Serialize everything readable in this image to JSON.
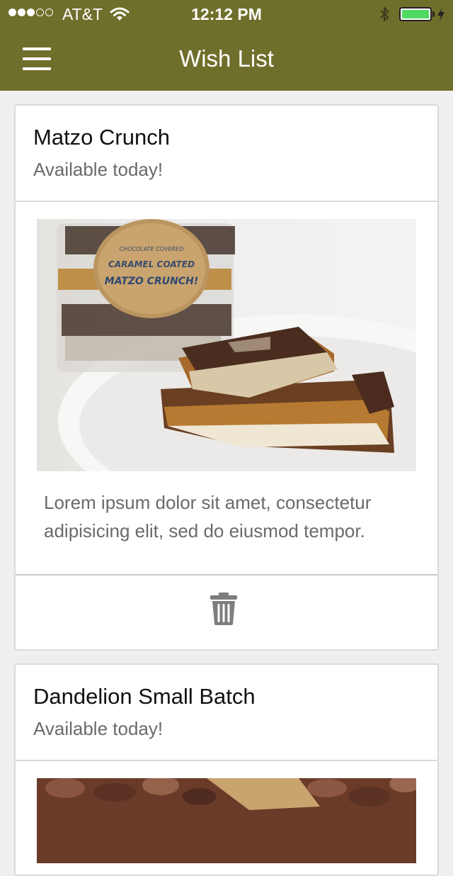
{
  "status_bar": {
    "carrier": "AT&T",
    "time": "12:12 PM",
    "signal_bars_filled": 3,
    "signal_bars_total": 5,
    "battery_level": 1.0,
    "battery_color": "#4cd964",
    "icons": [
      "wifi-icon",
      "bluetooth-icon",
      "battery-icon",
      "charging-icon"
    ]
  },
  "nav": {
    "title": "Wish List",
    "menu_icon": "hamburger-menu-icon",
    "bar_color": "#6f6f2c"
  },
  "items": [
    {
      "title": "Matzo Crunch",
      "subtitle": "Available today!",
      "description": "Lorem ipsum dolor sit amet, consectetur adipisicing elit, sed do eiusmod tempor.",
      "photo_label_lines": [
        "CHOCOLATE COVERED",
        "CARAMEL COATED",
        "MATZO CRUNCH!"
      ],
      "delete_icon": "trash-icon"
    },
    {
      "title": "Dandelion Small Batch",
      "subtitle": "Available today!"
    }
  ]
}
